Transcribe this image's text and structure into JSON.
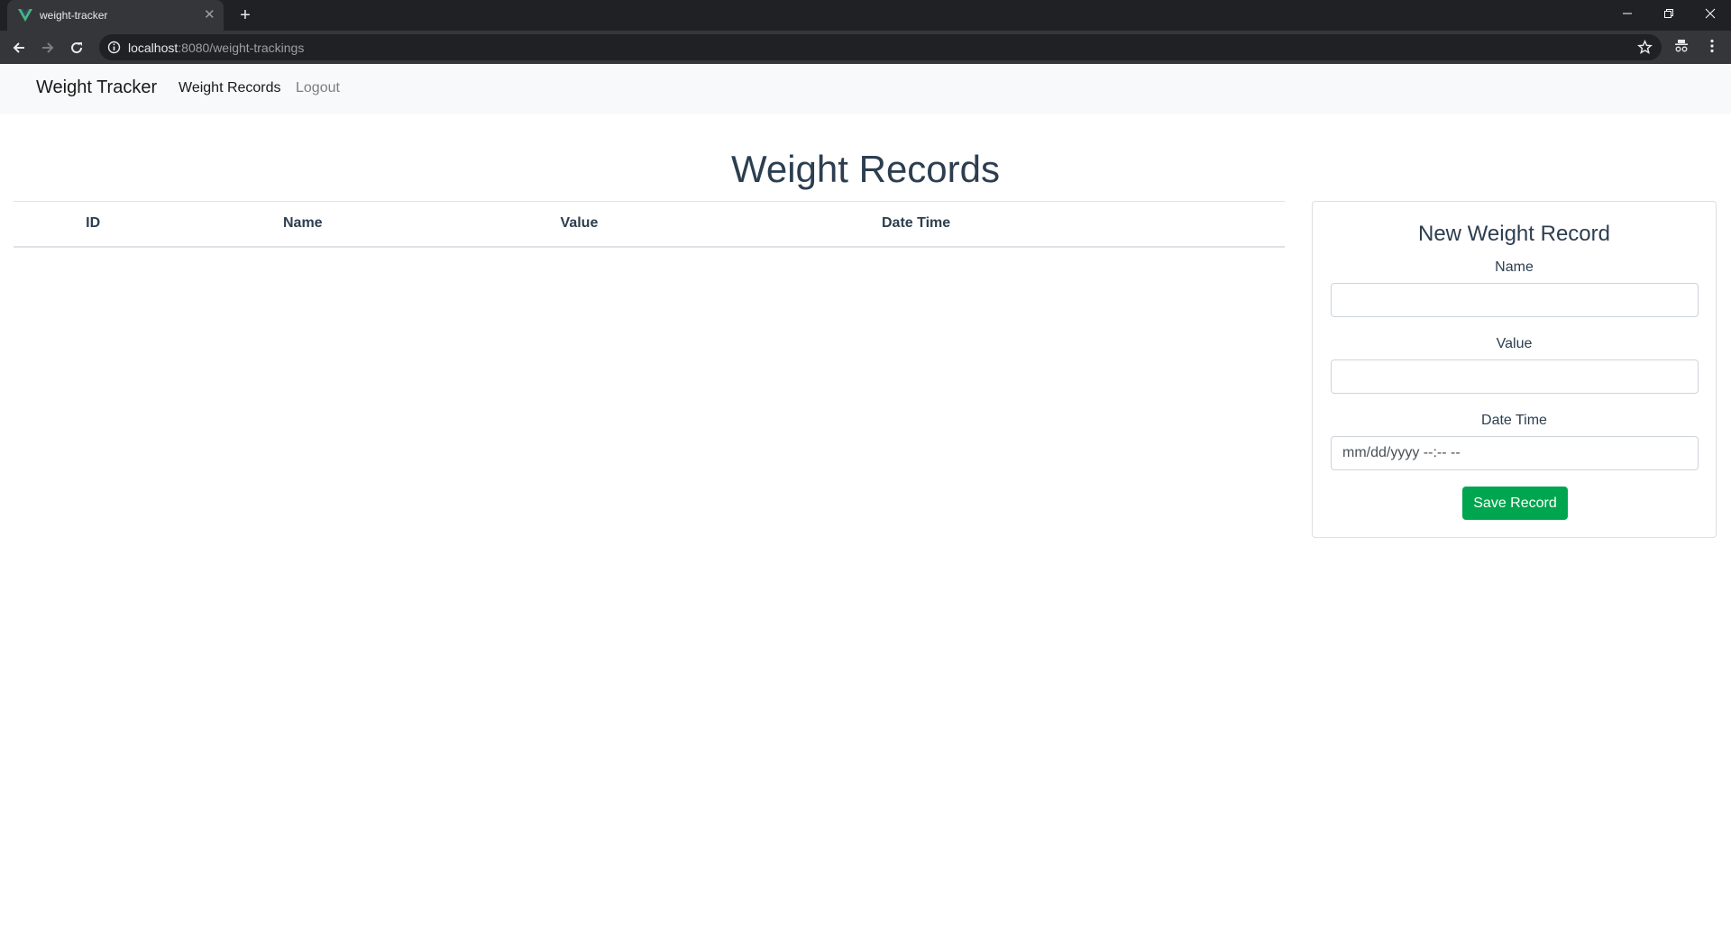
{
  "browser": {
    "tab_title": "weight-tracker",
    "tab_favicon": "vue-logo-icon",
    "url_host": "localhost",
    "url_rest": ":8080/weight-trackings",
    "colors": {
      "frame": "#202124",
      "toolbar": "#35363a",
      "favicon": "#41b883"
    }
  },
  "navbar": {
    "brand": "Weight Tracker",
    "links": [
      {
        "label": "Weight Records",
        "active": true
      },
      {
        "label": "Logout",
        "active": false
      }
    ]
  },
  "main": {
    "title": "Weight Records",
    "table": {
      "columns": [
        "ID",
        "Name",
        "Value",
        "Date Time"
      ],
      "rows": []
    }
  },
  "form": {
    "title": "New Weight Record",
    "fields": [
      {
        "label": "Name",
        "value": "",
        "placeholder": ""
      },
      {
        "label": "Value",
        "value": "",
        "placeholder": ""
      },
      {
        "label": "Date Time",
        "value": "",
        "placeholder": "mm/dd/yyyy --:-- --"
      }
    ],
    "submit_label": "Save Record",
    "submit_color": "#00a64f"
  }
}
